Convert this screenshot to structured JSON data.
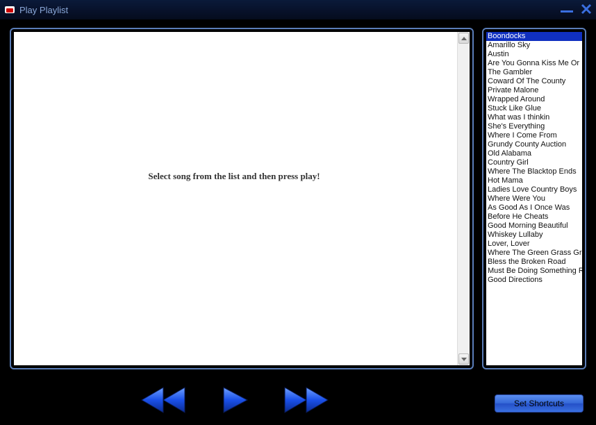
{
  "window": {
    "title": "Play Playlist"
  },
  "video": {
    "message": "Select song from the list and then press play!"
  },
  "playlist": {
    "selected_index": 0,
    "items": [
      "Boondocks",
      "Amarillo Sky",
      "Austin",
      "Are You Gonna Kiss Me Or Not",
      "The Gambler",
      "Coward Of The County",
      "Private Malone",
      "Wrapped Around",
      "Stuck Like Glue",
      "What was I thinkin",
      "She's Everything",
      "Where I Come From",
      "Grundy County Auction",
      "Old Alabama",
      "Country Girl",
      "Where The Blacktop Ends",
      "Hot Mama",
      "Ladies Love Country Boys",
      "Where Were You",
      "As Good As I Once Was",
      "Before He Cheats",
      "Good Morning Beautiful",
      "Whiskey Lullaby",
      "Lover, Lover",
      "Where The Green Grass Grows",
      "Bless the Broken Road",
      "Must Be Doing Something Right",
      "Good Directions"
    ]
  },
  "buttons": {
    "set_shortcuts": "Set Shortcuts"
  },
  "colors": {
    "frame": "#5a7db8",
    "accent": "#2a60e0"
  }
}
